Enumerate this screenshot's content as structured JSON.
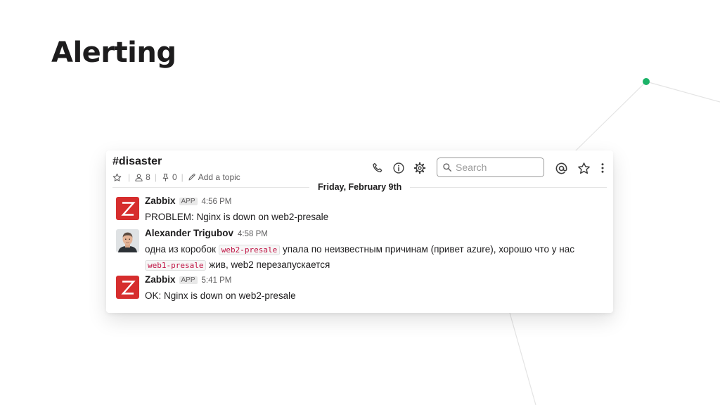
{
  "slide": {
    "title": "Alerting"
  },
  "channel": {
    "name": "#disaster",
    "members_count": "8",
    "pins_count": "0",
    "topic_placeholder": "Add a topic"
  },
  "toolbar": {
    "search_placeholder": "Search",
    "icons": [
      "phone-icon",
      "info-icon",
      "gear-icon",
      "search-icon",
      "at-icon",
      "star-icon",
      "more-vertical-icon"
    ]
  },
  "date_divider": "Friday, February 9th",
  "messages": [
    {
      "sender": "Zabbix",
      "badge": "APP",
      "time": "4:56 PM",
      "text": "PROBLEM: Nginx is down on web2-presale"
    },
    {
      "sender": "Alexander Trigubov",
      "time": "4:58 PM",
      "line1_a": "одна из коробок",
      "code1": "web2-presale",
      "line1_b": "упала по неизвестным причинам (привет azure), хорошо что у нас",
      "code2": "web1-presale",
      "line2": "жив, web2 перезапускается"
    },
    {
      "sender": "Zabbix",
      "badge": "APP",
      "time": "5:41 PM",
      "text": "OK: Nginx is down on web2-presale"
    }
  ],
  "colors": {
    "accent_dot": "#1bb267",
    "zabbix_red": "#d62d2d",
    "code_text": "#c01343"
  }
}
